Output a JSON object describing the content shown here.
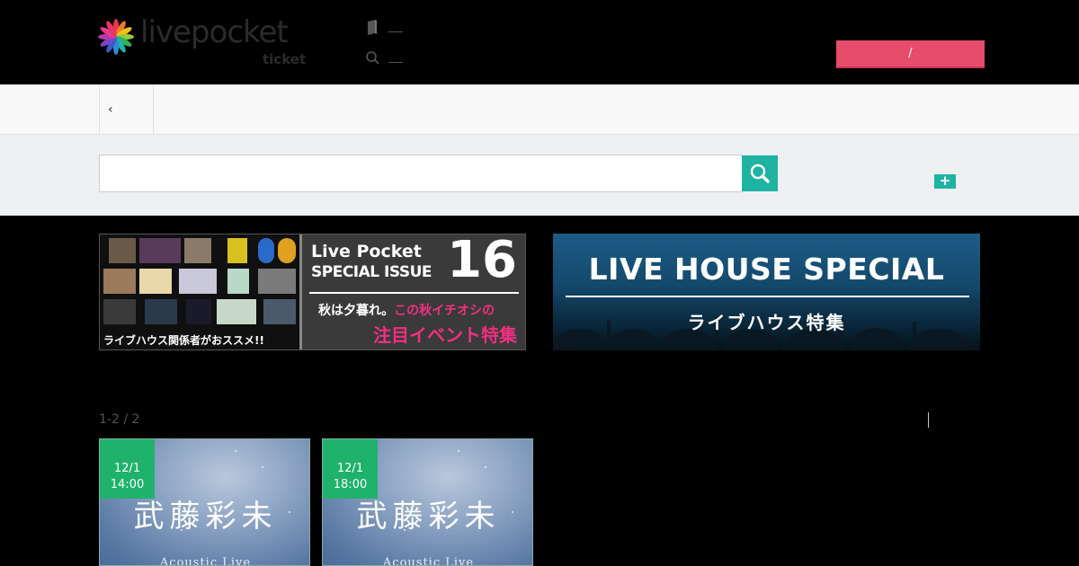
{
  "header": {
    "logo_text": "livepocket",
    "logo_sub": "ticket",
    "login_label": "/"
  },
  "breadcrumb": {
    "back_label": "‹"
  },
  "search": {
    "placeholder": "",
    "value": "",
    "plus_label": "+"
  },
  "banners": [
    {
      "line1": "Live Pocket",
      "line2": "SPECIAL ISSUE",
      "number": "16",
      "line3_a": "秋は夕暮れ。",
      "line3_b": "この秋イチオシの",
      "line4": "注目イベント特集",
      "caption": "ライブハウス関係者がおススメ!!"
    },
    {
      "title": "LIVE HOUSE SPECIAL",
      "subtitle": "ライブハウス特集"
    }
  ],
  "results": {
    "count": "1-2 / 2",
    "cards": [
      {
        "date": "12/1",
        "time": "14:00",
        "title": "武藤彩未",
        "subtitle": "Acoustic Live"
      },
      {
        "date": "12/1",
        "time": "18:00",
        "title": "武藤彩未",
        "subtitle": "Acoustic Live"
      }
    ]
  },
  "colors": {
    "accent_teal": "#1fb3a2",
    "login_pink": "#e84c6b",
    "badge_green": "#1fb26a",
    "banner_pink": "#f0307e"
  }
}
